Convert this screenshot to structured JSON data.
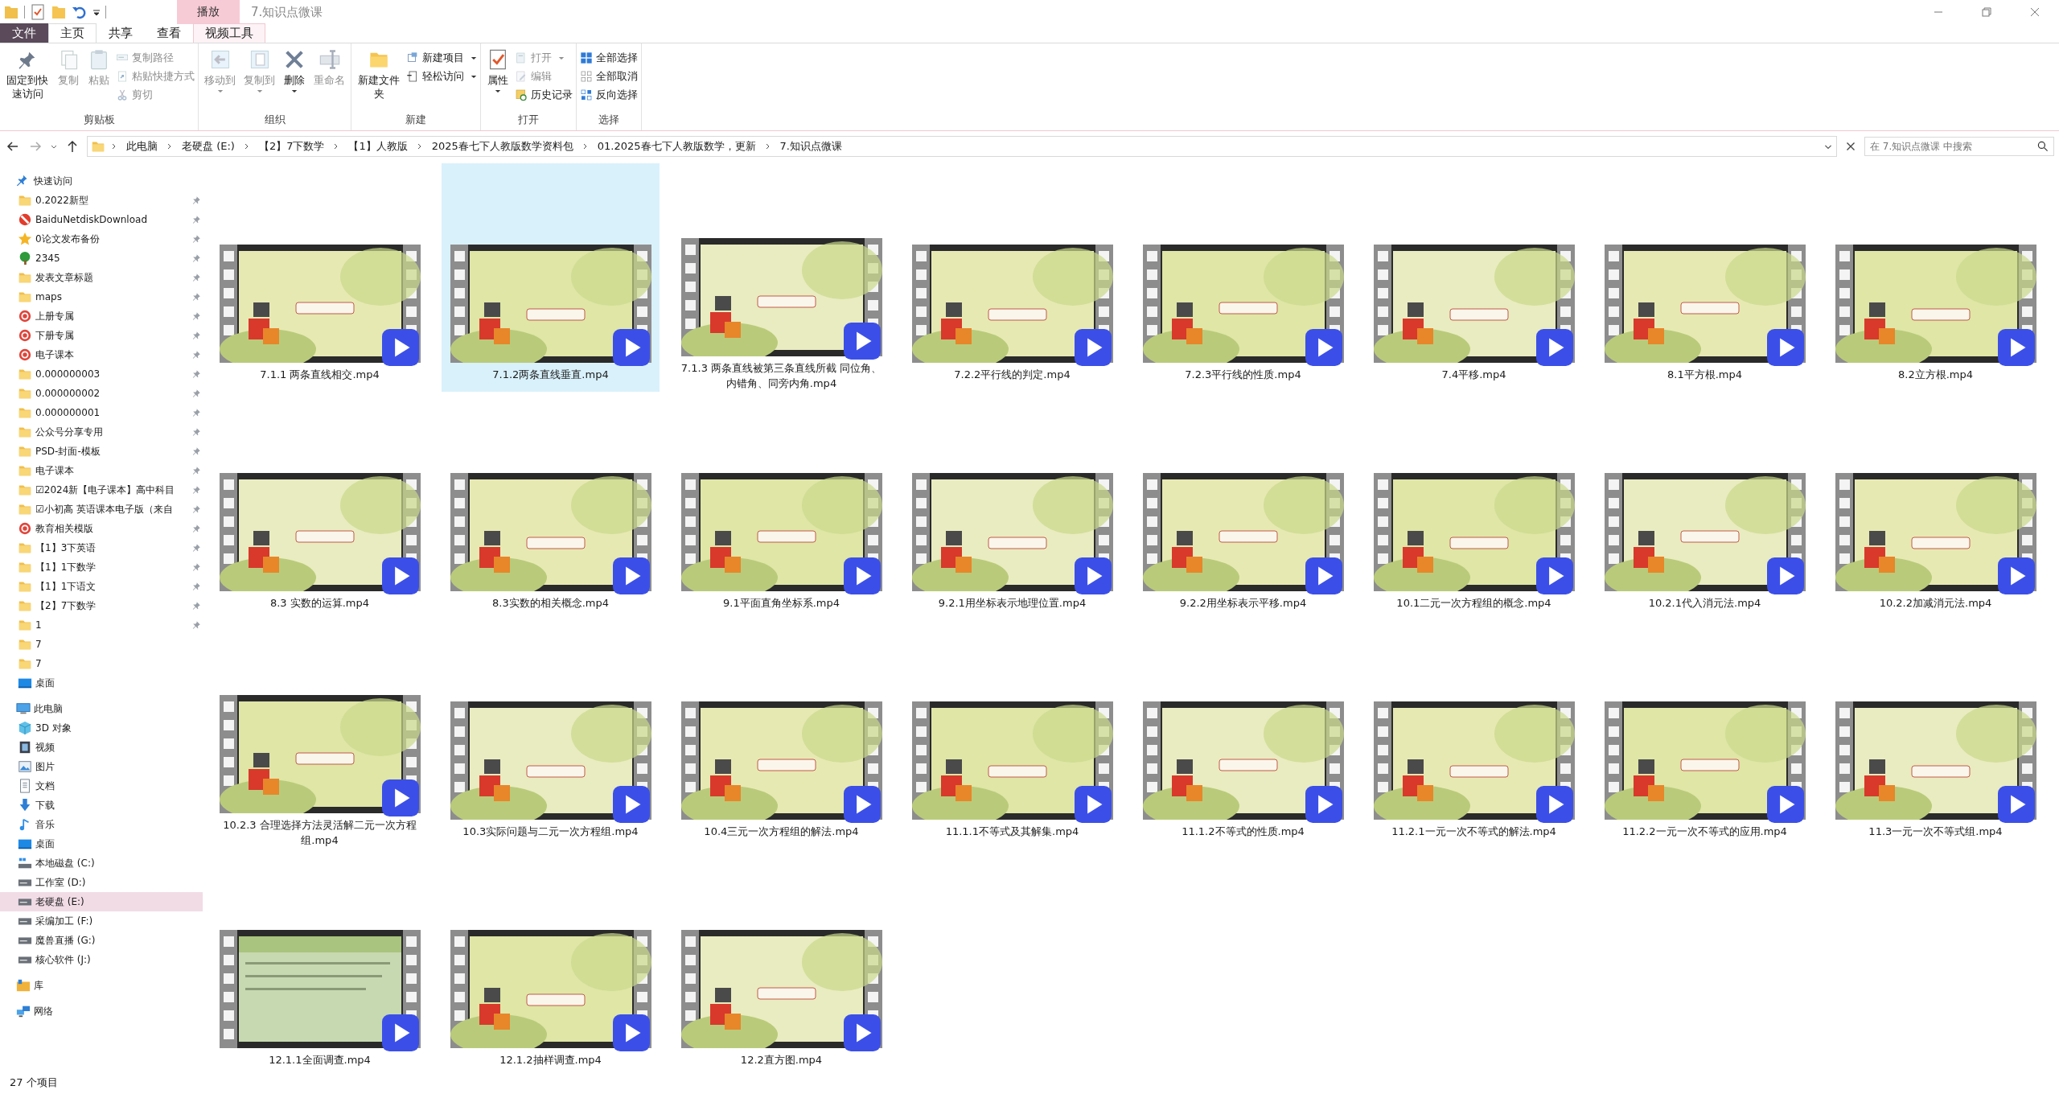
{
  "title_bar": {
    "context_tab": "播放",
    "title": "7.知识点微课"
  },
  "ribbon": {
    "tabs": [
      {
        "label": "文件",
        "kind": "file",
        "selected": false
      },
      {
        "label": "主页",
        "kind": "tab",
        "selected": true
      },
      {
        "label": "共享",
        "kind": "tab",
        "selected": false
      },
      {
        "label": "查看",
        "kind": "tab",
        "selected": false
      },
      {
        "label": "视频工具",
        "kind": "tab",
        "selected": false
      }
    ],
    "groups": [
      {
        "label": "剪贴板",
        "buttons": [
          {
            "label": "固定到快速访问",
            "kind": "large",
            "disabled": false,
            "dropdown": false
          },
          {
            "label": "复制",
            "kind": "large",
            "disabled": true,
            "dropdown": false
          },
          {
            "label": "粘贴",
            "kind": "large",
            "disabled": true,
            "dropdown": false
          },
          {
            "label": "复制路径",
            "kind": "small",
            "disabled": true,
            "dropdown": false
          },
          {
            "label": "粘贴快捷方式",
            "kind": "small",
            "disabled": true,
            "dropdown": false
          },
          {
            "label": "剪切",
            "kind": "small",
            "disabled": true,
            "dropdown": false
          }
        ]
      },
      {
        "label": "组织",
        "buttons": [
          {
            "label": "移动到",
            "kind": "large",
            "disabled": true,
            "dropdown": true
          },
          {
            "label": "复制到",
            "kind": "large",
            "disabled": true,
            "dropdown": true
          },
          {
            "label": "删除",
            "kind": "large",
            "disabled": false,
            "dropdown": true
          },
          {
            "label": "重命名",
            "kind": "large",
            "disabled": true,
            "dropdown": false
          }
        ]
      },
      {
        "label": "新建",
        "buttons": [
          {
            "label": "新建文件夹",
            "kind": "large",
            "disabled": false,
            "dropdown": false
          },
          {
            "label": "新建项目",
            "kind": "small",
            "disabled": false,
            "dropdown": true
          },
          {
            "label": "轻松访问",
            "kind": "small",
            "disabled": false,
            "dropdown": true
          }
        ]
      },
      {
        "label": "打开",
        "buttons": [
          {
            "label": "属性",
            "kind": "large",
            "disabled": false,
            "dropdown": true
          },
          {
            "label": "打开",
            "kind": "small",
            "disabled": true,
            "dropdown": true
          },
          {
            "label": "编辑",
            "kind": "small",
            "disabled": true,
            "dropdown": false
          },
          {
            "label": "历史记录",
            "kind": "small",
            "disabled": false,
            "dropdown": false
          }
        ]
      },
      {
        "label": "选择",
        "buttons": [
          {
            "label": "全部选择",
            "kind": "small",
            "disabled": false,
            "dropdown": false
          },
          {
            "label": "全部取消",
            "kind": "small",
            "disabled": false,
            "dropdown": false
          },
          {
            "label": "反向选择",
            "kind": "small",
            "disabled": false,
            "dropdown": false
          }
        ]
      }
    ]
  },
  "address_bar": {
    "path": [
      "此电脑",
      "老硬盘 (E:)",
      "【2】7下数学",
      "【1】人教版",
      "2025春七下人教版数学资料包",
      "01.2025春七下人教版数学，更新",
      "7.知识点微课"
    ],
    "search_placeholder": "在 7.知识点微课 中搜索"
  },
  "navigation": [
    {
      "label": "快速访问",
      "selected": false,
      "children": [
        {
          "label": "0.2022新型",
          "pinned": true,
          "selected": false
        },
        {
          "label": "BaiduNetdiskDownload",
          "pinned": true,
          "selected": false
        },
        {
          "label": "0论文发布备份",
          "pinned": true,
          "selected": false
        },
        {
          "label": "2345",
          "pinned": true,
          "selected": false
        },
        {
          "label": "发表文章标题",
          "pinned": true,
          "selected": false
        },
        {
          "label": "maps",
          "pinned": true,
          "selected": false
        },
        {
          "label": "上册专属",
          "pinned": true,
          "selected": false
        },
        {
          "label": "下册专属",
          "pinned": true,
          "selected": false
        },
        {
          "label": "电子课本",
          "pinned": true,
          "selected": false
        },
        {
          "label": "0.000000003",
          "pinned": true,
          "selected": false
        },
        {
          "label": "0.000000002",
          "pinned": true,
          "selected": false
        },
        {
          "label": "0.000000001",
          "pinned": true,
          "selected": false
        },
        {
          "label": "公众号分享专用",
          "pinned": true,
          "selected": false
        },
        {
          "label": "PSD-封面-模板",
          "pinned": true,
          "selected": false
        },
        {
          "label": "电子课本",
          "pinned": true,
          "selected": false
        },
        {
          "label": "☑2024新【电子课本】高中科目",
          "pinned": true,
          "selected": false
        },
        {
          "label": "☑小初高 英语课本电子版（来自",
          "pinned": true,
          "selected": false
        },
        {
          "label": "教育相关模版",
          "pinned": true,
          "selected": false
        },
        {
          "label": "【1】3下英语",
          "pinned": true,
          "selected": false
        },
        {
          "label": "【1】1下数学",
          "pinned": true,
          "selected": false
        },
        {
          "label": "【1】1下语文",
          "pinned": true,
          "selected": false
        },
        {
          "label": "【2】7下数学",
          "pinned": true,
          "selected": false
        },
        {
          "label": "1",
          "pinned": true,
          "selected": false
        },
        {
          "label": "7",
          "pinned": false,
          "selected": false
        },
        {
          "label": "7",
          "pinned": false,
          "selected": false
        },
        {
          "label": "桌面",
          "pinned": false,
          "selected": false
        }
      ]
    },
    {
      "label": "此电脑",
      "selected": false,
      "children": [
        {
          "label": "3D 对象",
          "selected": false
        },
        {
          "label": "视频",
          "selected": false
        },
        {
          "label": "图片",
          "selected": false
        },
        {
          "label": "文档",
          "selected": false
        },
        {
          "label": "下载",
          "selected": false
        },
        {
          "label": "音乐",
          "selected": false
        },
        {
          "label": "桌面",
          "selected": false
        },
        {
          "label": "本地磁盘 (C:)",
          "selected": false
        },
        {
          "label": "工作室 (D:)",
          "selected": false
        },
        {
          "label": "老硬盘 (E:)",
          "selected": true
        },
        {
          "label": "采编加工 (F:)",
          "selected": false
        },
        {
          "label": "魔兽直播 (G:)",
          "selected": false
        },
        {
          "label": "核心软件 (J:)",
          "selected": false
        }
      ]
    },
    {
      "label": "库",
      "selected": false
    },
    {
      "label": "网络",
      "selected": false
    }
  ],
  "files": [
    {
      "name": "7.1.1 两条直线相交.mp4",
      "selected": false
    },
    {
      "name": "7.1.2两条直线垂直.mp4",
      "selected": true
    },
    {
      "name": "7.1.3 两条直线被第三条直线所截 同位角、内错角、同旁内角.mp4",
      "selected": false
    },
    {
      "name": "7.2.2平行线的判定.mp4",
      "selected": false
    },
    {
      "name": "7.2.3平行线的性质.mp4",
      "selected": false
    },
    {
      "name": "7.4平移.mp4",
      "selected": false
    },
    {
      "name": "8.1平方根.mp4",
      "selected": false
    },
    {
      "name": "8.2立方根.mp4",
      "selected": false
    },
    {
      "name": "8.3 实数的运算.mp4",
      "selected": false
    },
    {
      "name": "8.3实数的相关概念.mp4",
      "selected": false
    },
    {
      "name": "9.1平面直角坐标系.mp4",
      "selected": false
    },
    {
      "name": "9.2.1用坐标表示地理位置.mp4",
      "selected": false
    },
    {
      "name": "9.2.2用坐标表示平移.mp4",
      "selected": false
    },
    {
      "name": "10.1二元一次方程组的概念.mp4",
      "selected": false
    },
    {
      "name": "10.2.1代入消元法.mp4",
      "selected": false
    },
    {
      "name": "10.2.2加减消元法.mp4",
      "selected": false
    },
    {
      "name": "10.2.3 合理选择方法灵活解二元一次方程组.mp4",
      "selected": false
    },
    {
      "name": "10.3实际问题与二元一次方程组.mp4",
      "selected": false
    },
    {
      "name": "10.4三元一次方程组的解法.mp4",
      "selected": false
    },
    {
      "name": "11.1.1不等式及其解集.mp4",
      "selected": false
    },
    {
      "name": "11.1.2不等式的性质.mp4",
      "selected": false
    },
    {
      "name": "11.2.1一元一次不等式的解法.mp4",
      "selected": false
    },
    {
      "name": "11.2.2一元一次不等式的应用.mp4",
      "selected": false
    },
    {
      "name": "11.3一元一次不等式组.mp4",
      "selected": false
    },
    {
      "name": "12.1.1全面调查.mp4",
      "selected": false
    },
    {
      "name": "12.1.2抽样调查.mp4",
      "selected": false
    },
    {
      "name": "12.2直方图.mp4",
      "selected": false
    }
  ],
  "status_bar": {
    "item_count": "27 个项目"
  }
}
